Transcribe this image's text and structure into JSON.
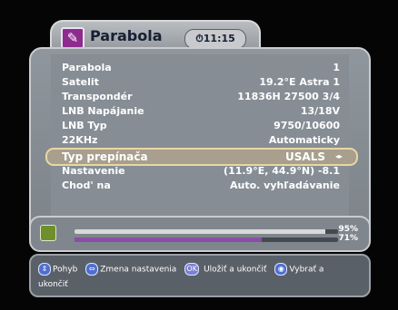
{
  "header": {
    "title": "Parabola",
    "clock": "11:15",
    "icon": "dish-edit-icon"
  },
  "settings": {
    "rows": [
      {
        "label": "Parabola",
        "value": "1"
      },
      {
        "label": "Satelit",
        "value": "19.2°E Astra 1"
      },
      {
        "label": "Transpondér",
        "value": "11836H 27500 3/4"
      },
      {
        "label": "LNB Napájanie",
        "value": "13/18V"
      },
      {
        "label": "LNB Typ",
        "value": "9750/10600"
      },
      {
        "label": "22KHz",
        "value": "Automaticky"
      },
      {
        "label": "Typ prepínača",
        "value": "USALS",
        "selected": true
      },
      {
        "label": "Nastavenie",
        "value": "(11.9°E, 44.9°N) -8.1"
      },
      {
        "label": "Chod' na",
        "value": "Auto. vyhľadávanie"
      }
    ]
  },
  "signal": {
    "strength": 95,
    "quality": 71,
    "strength_label": "95%",
    "quality_label": "71%"
  },
  "help": {
    "move": "Pohyb",
    "change": "Zmena nastavenia",
    "save": "Uložiť a ukončiť",
    "select_prefix": "Vybrať a",
    "select_suffix": "ukončiť",
    "ok_key": "OK"
  },
  "colors": {
    "panel": "#868d95",
    "selected_row": "#a89f8f",
    "quality_bar": "#8a4ea6"
  }
}
